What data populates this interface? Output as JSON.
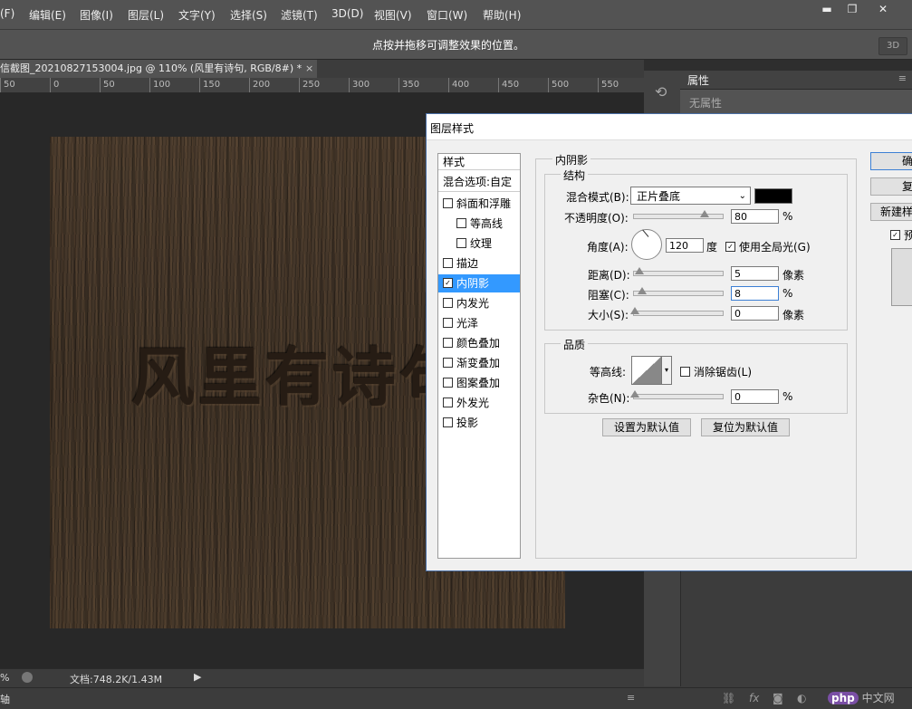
{
  "menubar": {
    "items": [
      "(F)",
      "编辑(E)",
      "图像(I)",
      "图层(L)",
      "文字(Y)",
      "选择(S)",
      "滤镜(T)",
      "3D(D)",
      "视图(V)",
      "窗口(W)",
      "帮助(H)"
    ],
    "window_buttons": [
      "▬",
      "❐",
      "✕"
    ]
  },
  "options_bar": {
    "hint": "点按并拖移可调整效果的位置。",
    "mode_3d": "3D"
  },
  "document": {
    "tab_title": "信截图_20210827153004.jpg @ 110% (风里有诗句, RGB/8#) *",
    "close": "×",
    "canvas_text": "风里有诗句"
  },
  "ruler": {
    "ticks": [
      "50",
      "0",
      "50",
      "100",
      "150",
      "200",
      "250",
      "300",
      "350",
      "400",
      "450",
      "500",
      "550"
    ]
  },
  "status": {
    "zoom": "%",
    "doc_info": "文档:748.2K/1.43M",
    "arrow": "▶"
  },
  "bottom_bar": {
    "axis_label": "轴",
    "menu": "≡",
    "icons": [
      "link-icon",
      "fx-icon",
      "mask-icon",
      "adjust-icon",
      "folder-icon",
      "new-layer-icon",
      "trash-icon"
    ],
    "watermark_logo": "php",
    "watermark_text": "中文网"
  },
  "properties_panel": {
    "tab": "属性",
    "empty_text": "无属性",
    "menu": "≡"
  },
  "dialog": {
    "title": "图层样式",
    "styles_header": "样式",
    "blend_options": "混合选项:自定",
    "style_items": [
      {
        "label": "斜面和浮雕",
        "checked": false,
        "indent": false
      },
      {
        "label": "等高线",
        "checked": false,
        "indent": true
      },
      {
        "label": "纹理",
        "checked": false,
        "indent": true
      },
      {
        "label": "描边",
        "checked": false,
        "indent": false
      },
      {
        "label": "内阴影",
        "checked": true,
        "indent": false,
        "selected": true
      },
      {
        "label": "内发光",
        "checked": false,
        "indent": false
      },
      {
        "label": "光泽",
        "checked": false,
        "indent": false
      },
      {
        "label": "颜色叠加",
        "checked": false,
        "indent": false
      },
      {
        "label": "渐变叠加",
        "checked": false,
        "indent": false
      },
      {
        "label": "图案叠加",
        "checked": false,
        "indent": false
      },
      {
        "label": "外发光",
        "checked": false,
        "indent": false
      },
      {
        "label": "投影",
        "checked": false,
        "indent": false
      }
    ],
    "section_title": "内阴影",
    "structure": {
      "title": "结构",
      "blend_mode_label": "混合模式(B):",
      "blend_mode_value": "正片叠底",
      "shadow_color": "#000000",
      "opacity_label": "不透明度(O):",
      "opacity_value": "80",
      "opacity_unit": "%",
      "angle_label": "角度(A):",
      "angle_value": "120",
      "angle_unit": "度",
      "global_light_label": "使用全局光(G)",
      "global_light_checked": true,
      "distance_label": "距离(D):",
      "distance_value": "5",
      "distance_unit": "像素",
      "choke_label": "阻塞(C):",
      "choke_value": "8",
      "choke_unit": "%",
      "size_label": "大小(S):",
      "size_value": "0",
      "size_unit": "像素"
    },
    "quality": {
      "title": "品质",
      "contour_label": "等高线:",
      "antialias_label": "消除锯齿(L)",
      "noise_label": "杂色(N):",
      "noise_value": "0",
      "noise_unit": "%"
    },
    "set_default": "设置为默认值",
    "reset_default": "复位为默认值",
    "right_buttons": [
      "确",
      "复",
      "新建样"
    ],
    "preview_label": "预"
  }
}
